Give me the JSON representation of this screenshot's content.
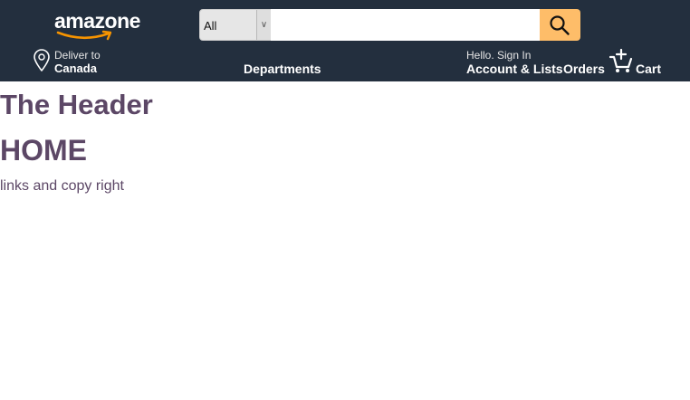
{
  "navbar": {
    "logo_text": "amazone",
    "search": {
      "category": "All",
      "query": "",
      "placeholder": ""
    },
    "deliver": {
      "line1": "Deliver to",
      "line2": "Canada"
    },
    "departments": "Departments",
    "account": {
      "line1": "Hello. Sign In",
      "line2": "Account & Lists"
    },
    "orders": "Orders",
    "cart": "Cart"
  },
  "main": {
    "header": "The Header",
    "home": "HOME",
    "footer": "links and copy right"
  },
  "colors": {
    "navbar_bg": "#232f3e",
    "search_button": "#febd69",
    "logo_smile": "#f79400",
    "main_text": "#5c4766"
  },
  "icons": {
    "search": "search-icon",
    "location": "location-pin-icon",
    "cart": "cart-icon",
    "dropdown": "chevron-down-icon"
  }
}
